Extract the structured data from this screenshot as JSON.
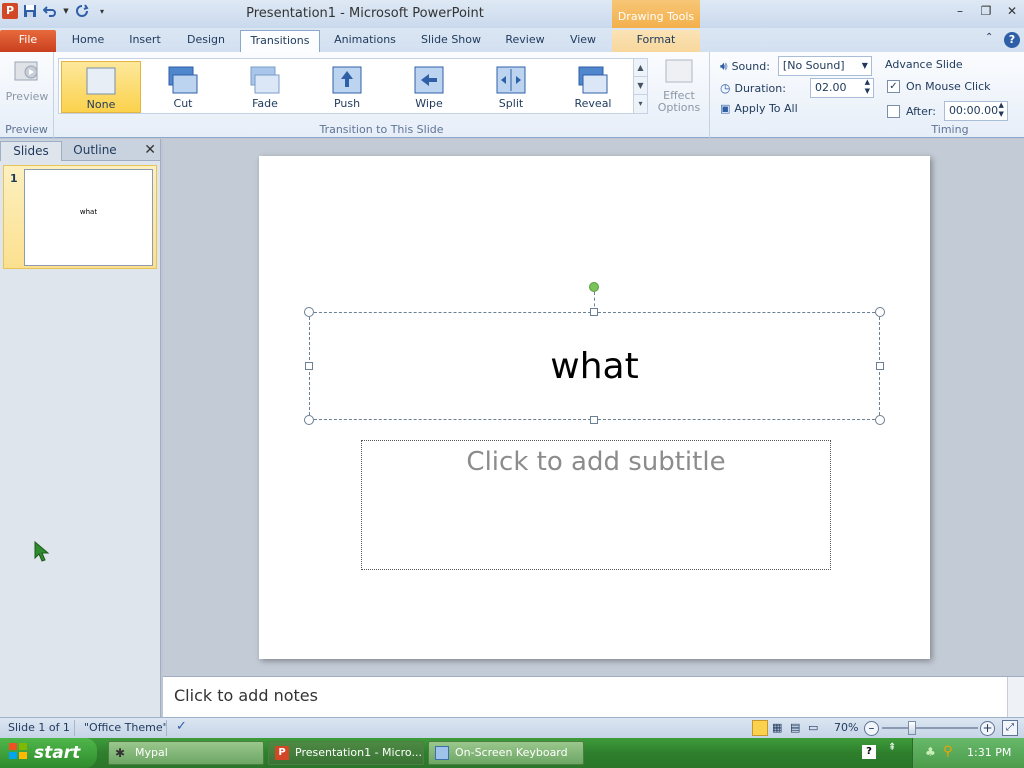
{
  "window": {
    "title": "Presentation1 - Microsoft PowerPoint",
    "contextual_tab": "Drawing Tools"
  },
  "tabs": [
    "File",
    "Home",
    "Insert",
    "Design",
    "Transitions",
    "Animations",
    "Slide Show",
    "Review",
    "View",
    "Format"
  ],
  "ribbon": {
    "preview_label": "Preview",
    "preview_group": "Preview",
    "transitions": [
      "None",
      "Cut",
      "Fade",
      "Push",
      "Wipe",
      "Split",
      "Reveal"
    ],
    "selected_transition": "None",
    "effect_options": "Effect Options",
    "transition_group": "Transition to This Slide",
    "sound_label": "Sound:",
    "sound_value": "[No Sound]",
    "duration_label": "Duration:",
    "duration_value": "02.00",
    "apply_all": "Apply To All",
    "advance_slide": "Advance Slide",
    "on_mouse_click": "On Mouse Click",
    "on_mouse_click_checked": true,
    "after_label": "After:",
    "after_value": "00:00.00",
    "after_checked": false,
    "timing_group": "Timing"
  },
  "left_panel": {
    "tab_slides": "Slides",
    "tab_outline": "Outline",
    "slide_number": "1",
    "thumb_title": "what"
  },
  "slide": {
    "title": "what",
    "subtitle_placeholder": "Click to add subtitle"
  },
  "notes": {
    "placeholder": "Click to add notes"
  },
  "statusbar": {
    "slide_info": "Slide 1 of 1",
    "theme": "\"Office Theme\"",
    "zoom": "70%"
  },
  "taskbar": {
    "start": "start",
    "items": [
      "Mypal",
      "Presentation1 - Micro...",
      "On-Screen Keyboard"
    ],
    "clock": "1:31 PM"
  },
  "colors": {
    "file_tab": "#d24726",
    "selected_gallery": "#fbd24d",
    "taskbar": "#2e7f2d"
  }
}
